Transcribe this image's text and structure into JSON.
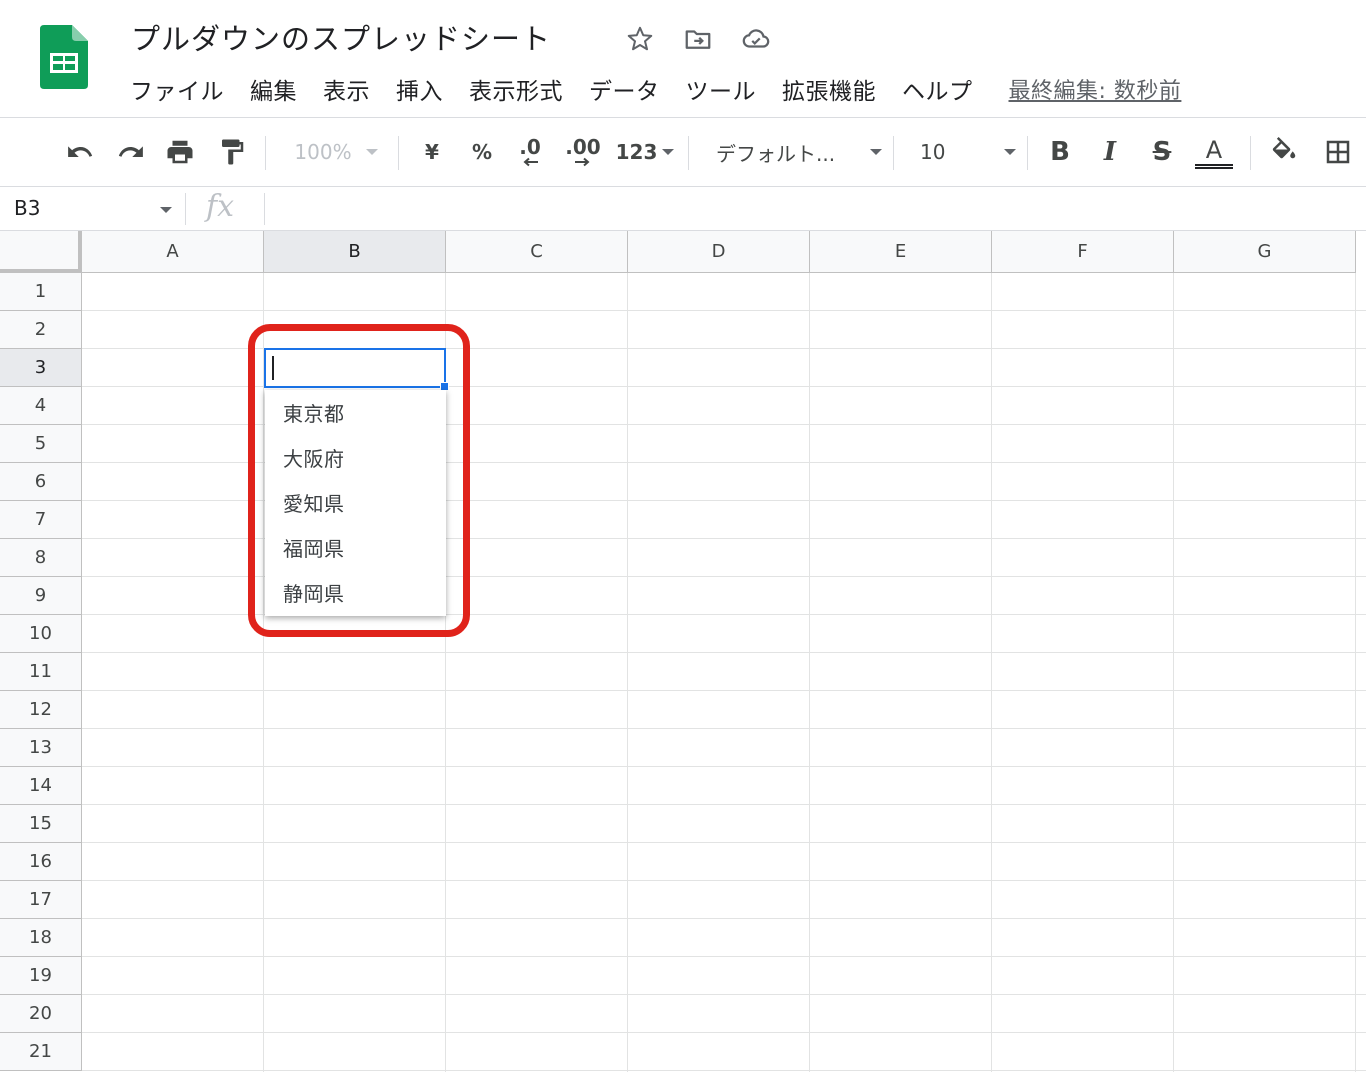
{
  "document": {
    "title": "プルダウンのスプレッドシート",
    "last_edit": "最終編集: 数秒前"
  },
  "menu": [
    "ファイル",
    "編集",
    "表示",
    "挿入",
    "表示形式",
    "データ",
    "ツール",
    "拡張機能",
    "ヘルプ"
  ],
  "toolbar": {
    "zoom": "100%",
    "currency": "¥",
    "percent": "%",
    "decimal_decrease": ".0",
    "decimal_increase": ".00",
    "number_format": "123",
    "font": "デフォルト...",
    "font_size": "10",
    "bold": "B",
    "italic": "I",
    "strikethrough": "S",
    "text_color": "A"
  },
  "formula_bar": {
    "name_box": "B3",
    "fx_label": "fx",
    "value": ""
  },
  "grid": {
    "columns": [
      "A",
      "B",
      "C",
      "D",
      "E",
      "F",
      "G"
    ],
    "rows": [
      "1",
      "2",
      "3",
      "4",
      "5",
      "6",
      "7",
      "8",
      "9",
      "10",
      "11",
      "12",
      "13",
      "14",
      "15",
      "16",
      "17",
      "18",
      "19",
      "20",
      "21"
    ],
    "selected_column": "B",
    "selected_row": "3"
  },
  "dropdown": {
    "options": [
      "東京都",
      "大阪府",
      "愛知県",
      "福岡県",
      "静岡県"
    ]
  },
  "colors": {
    "selection": "#1a73e8",
    "highlight": "#e0231b",
    "sheets_green": "#0f9d58"
  }
}
